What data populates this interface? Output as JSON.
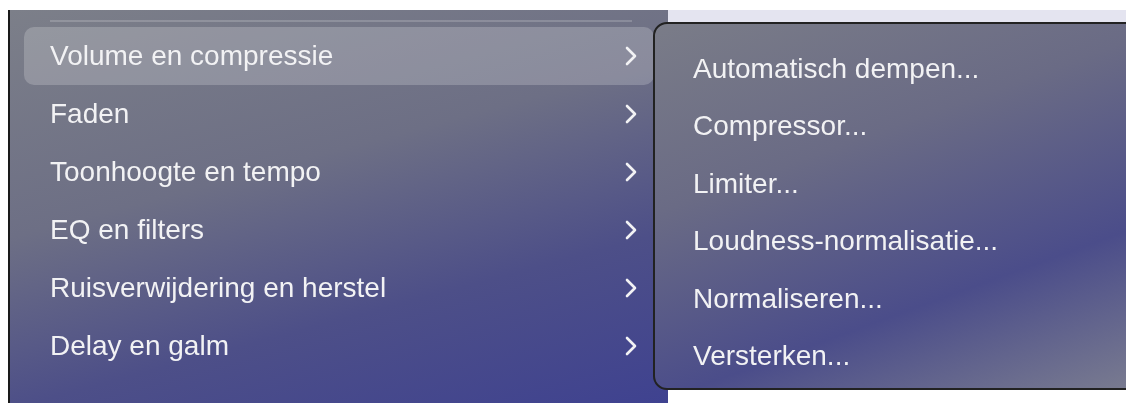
{
  "menu": {
    "items": [
      {
        "label": "Volume en compressie",
        "selected": true
      },
      {
        "label": "Faden",
        "selected": false
      },
      {
        "label": "Toonhoogte en tempo",
        "selected": false
      },
      {
        "label": "EQ en filters",
        "selected": false
      },
      {
        "label": "Ruisverwijdering en herstel",
        "selected": false
      },
      {
        "label": "Delay en galm",
        "selected": false
      }
    ]
  },
  "submenu": {
    "items": [
      {
        "label": "Automatisch dempen..."
      },
      {
        "label": "Compressor..."
      },
      {
        "label": "Limiter..."
      },
      {
        "label": "Loudness-normalisatie..."
      },
      {
        "label": "Normaliseren..."
      },
      {
        "label": "Versterken..."
      }
    ]
  }
}
